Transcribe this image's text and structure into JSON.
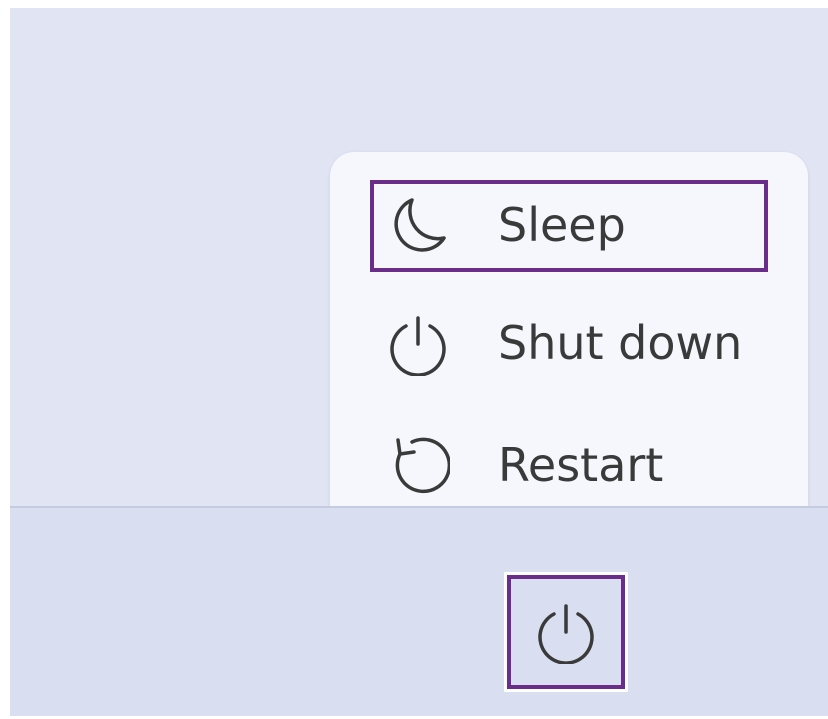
{
  "power_menu": {
    "items": [
      {
        "label": "Sleep",
        "icon": "moon-icon",
        "focused": true
      },
      {
        "label": "Shut down",
        "icon": "power-icon",
        "focused": false
      },
      {
        "label": "Restart",
        "icon": "restart-icon",
        "focused": false
      }
    ]
  },
  "taskbar": {
    "power_button_icon": "power-icon"
  },
  "colors": {
    "desktop_bg": "#e0e4f3",
    "taskbar_bg": "#d9dff1",
    "menu_bg": "#f5f7fc",
    "focus_outline": "#6a2e8a",
    "text": "#3a3a3a"
  }
}
